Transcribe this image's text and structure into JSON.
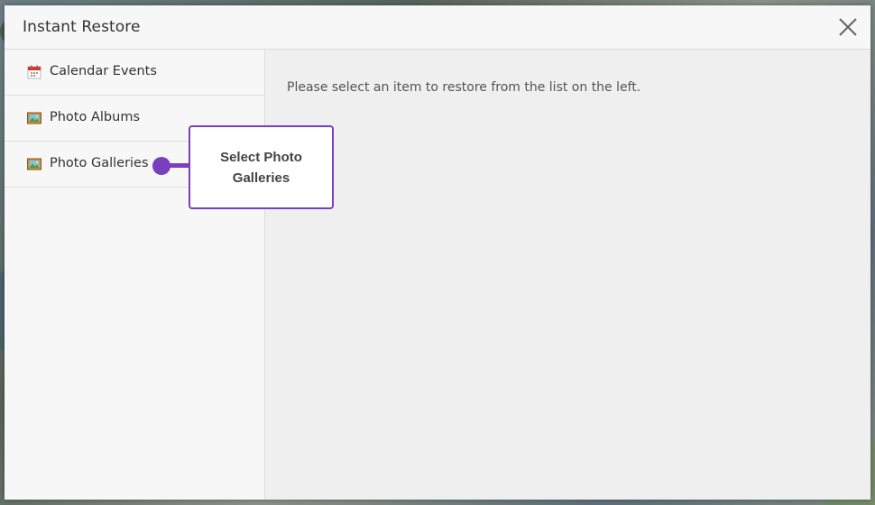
{
  "dialog": {
    "title": "Instant Restore",
    "close_icon": "close-icon"
  },
  "sidebar": {
    "items": [
      {
        "label": "Calendar Events",
        "icon": "calendar-icon"
      },
      {
        "label": "Photo Albums",
        "icon": "photo-icon"
      },
      {
        "label": "Photo Galleries",
        "icon": "photo-icon"
      }
    ]
  },
  "main": {
    "hint": "Please select an item to restore from the list on the left."
  },
  "callout": {
    "text": "Select Photo Galleries",
    "color": "#7a3fbf"
  }
}
